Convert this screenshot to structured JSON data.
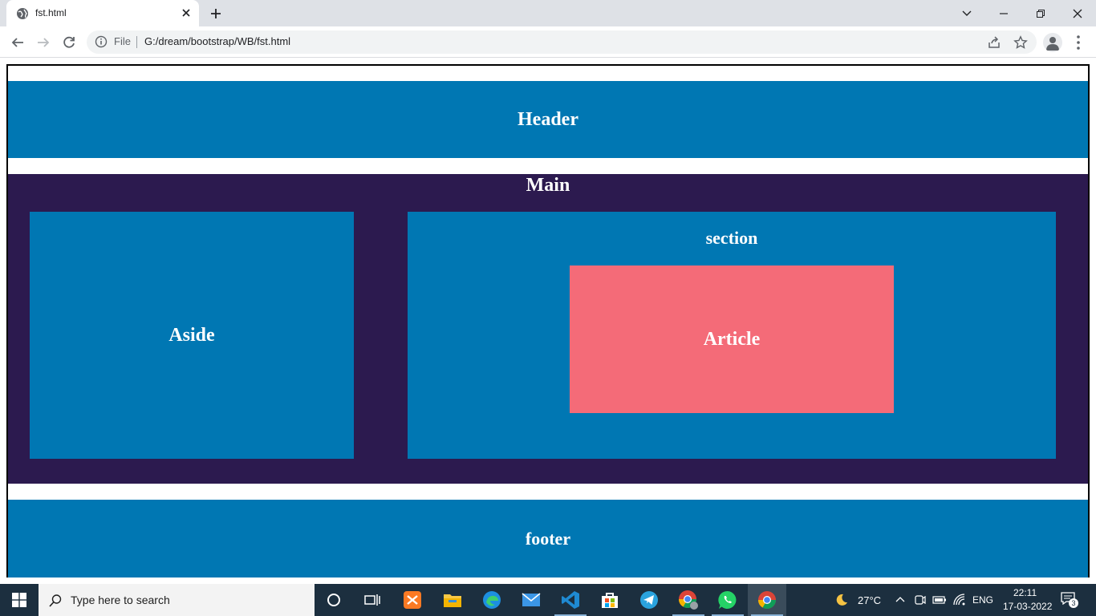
{
  "browser": {
    "tab_title": "fst.html",
    "chip_label": "File",
    "url": "G:/dream/bootstrap/WB/fst.html"
  },
  "page": {
    "header": "Header",
    "main": "Main",
    "aside": "Aside",
    "section": "section",
    "article": "Article",
    "footer": "footer"
  },
  "colors": {
    "blue_block": "#0077b3",
    "main_bg": "#2c1a4f",
    "article_bg": "#f46b78"
  },
  "taskbar": {
    "search_placeholder": "Type here to search",
    "pinned_icons": [
      "cortana-icon",
      "task-view-icon",
      "xampp-icon",
      "file-explorer-icon",
      "edge-icon",
      "mail-icon",
      "vscode-icon",
      "store-icon",
      "telegram-icon",
      "chrome-profile-icon",
      "whatsapp-icon",
      "chrome-icon"
    ],
    "temperature": "27°C",
    "language": "ENG",
    "time": "22:11",
    "date": "17-03-2022",
    "notification_count": "3"
  }
}
